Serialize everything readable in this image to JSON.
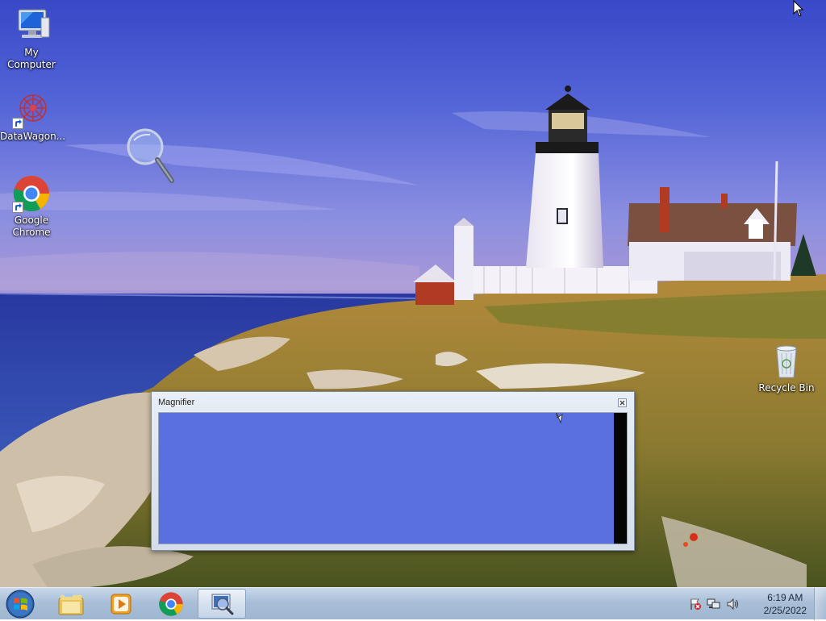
{
  "desktop": {
    "icons": [
      {
        "label": "My Computer",
        "icon": "computer-icon"
      },
      {
        "label": "DataWagon...",
        "icon": "datawagon-icon",
        "shortcut": true
      },
      {
        "label": "Google Chrome",
        "icon": "chrome-icon",
        "shortcut": true
      },
      {
        "label": "Recycle Bin",
        "icon": "recycle-bin-icon"
      }
    ]
  },
  "magnifier": {
    "title": "Magnifier",
    "close_icon": "close-icon",
    "view_color": "#5a6fe0"
  },
  "taskbar": {
    "start_icon": "windows-start-icon",
    "pinned": [
      {
        "icon": "file-explorer-icon"
      },
      {
        "icon": "media-player-icon"
      },
      {
        "icon": "chrome-icon"
      },
      {
        "icon": "magnifier-icon",
        "active": true
      }
    ],
    "tray": {
      "icons": [
        "action-center-flag-icon",
        "network-icon",
        "volume-icon"
      ],
      "time": "6:19 AM",
      "date": "2/25/2022"
    }
  }
}
